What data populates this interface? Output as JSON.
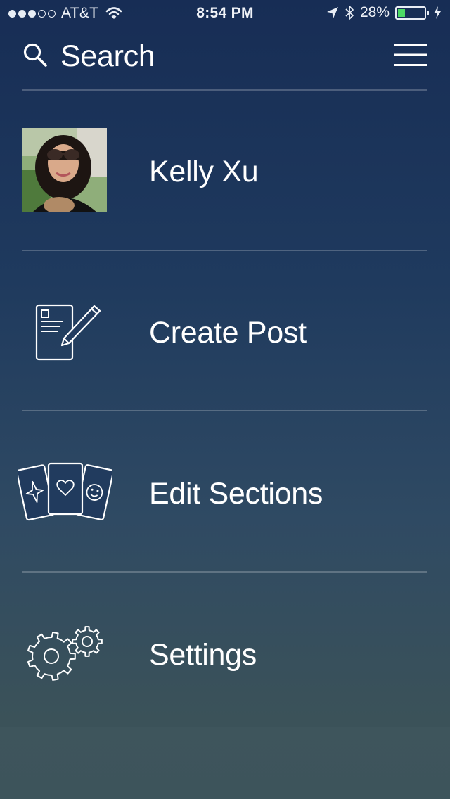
{
  "status_bar": {
    "signal_bars_filled": 3,
    "signal_bars_total": 5,
    "carrier": "AT&T",
    "time": "8:54 PM",
    "battery_percent": "28%",
    "battery_level": 0.28,
    "icons": [
      "wifi-icon",
      "location-arrow-icon",
      "bluetooth-icon",
      "battery-icon",
      "charging-bolt-icon"
    ]
  },
  "header": {
    "search_label": "Search",
    "icons": [
      "search-icon",
      "menu-icon"
    ]
  },
  "menu": {
    "profile": {
      "name": "Kelly Xu",
      "icon": "avatar"
    },
    "create_post": {
      "label": "Create Post",
      "icon": "create-post-icon"
    },
    "edit_sections": {
      "label": "Edit Sections",
      "icon": "cards-icon"
    },
    "settings": {
      "label": "Settings",
      "icon": "gears-icon"
    }
  },
  "colors": {
    "background_top": "#172d55",
    "background_bottom": "#3a5158",
    "battery_fill": "#4cd964",
    "text": "#ffffff"
  }
}
